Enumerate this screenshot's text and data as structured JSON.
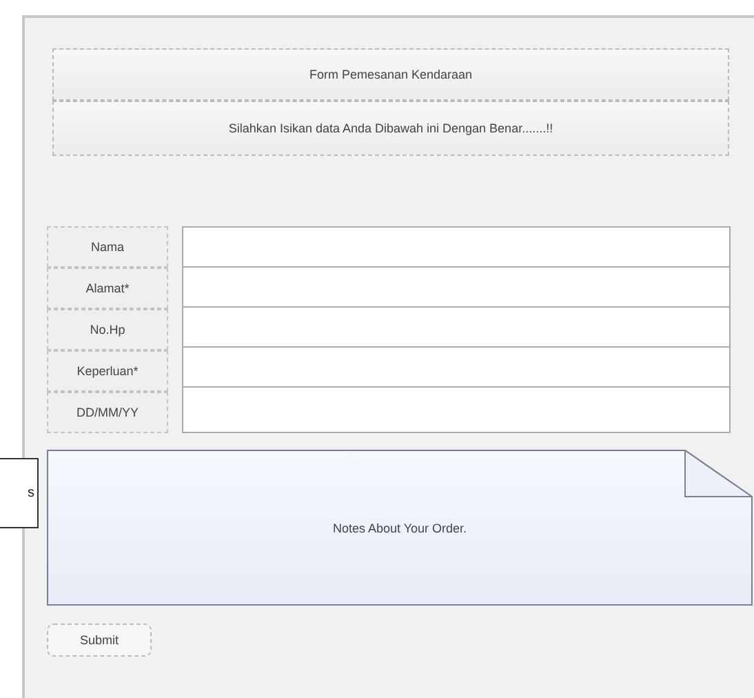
{
  "header": {
    "title": "Form Pemesanan Kendaraan",
    "subtitle": "Silahkan Isikan data Anda Dibawah ini Dengan Benar.......!!"
  },
  "fields": [
    {
      "label": "Nama"
    },
    {
      "label": "Alamat*"
    },
    {
      "label": "No.Hp"
    },
    {
      "label": "Keperluan*"
    },
    {
      "label": "DD/MM/YY"
    }
  ],
  "note": {
    "text": "Notes About Your Order."
  },
  "submit": {
    "label": "Submit"
  },
  "callout": {
    "text": "s"
  }
}
